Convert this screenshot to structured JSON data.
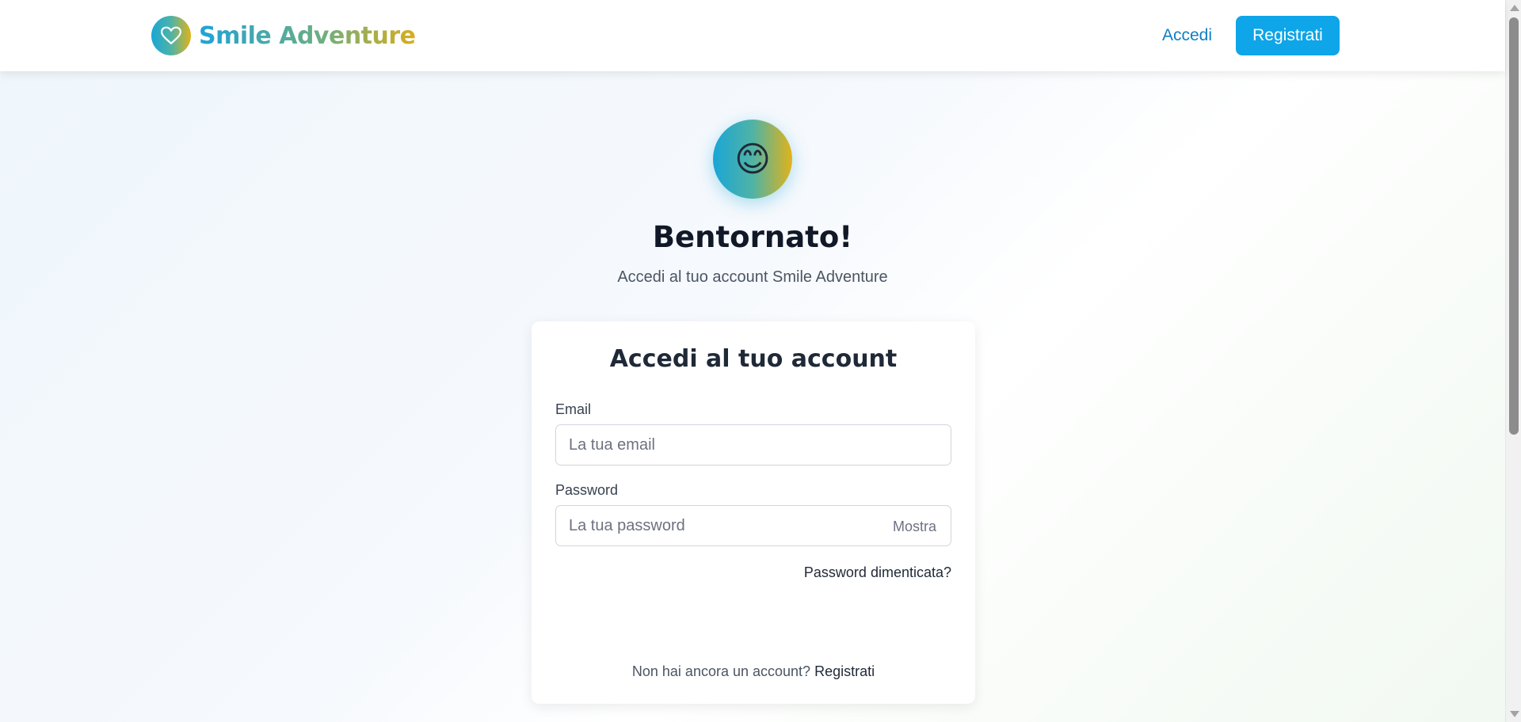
{
  "header": {
    "brand_name": "Smile Adventure",
    "brand_icon": "heart-icon",
    "nav_login_label": "Accedi",
    "nav_register_label": "Registrati"
  },
  "hero": {
    "icon": "smiling-face-emoji",
    "emoji": "😊",
    "title": "Bentornato!",
    "subtitle": "Accedi al tuo account Smile Adventure"
  },
  "login_form": {
    "title": "Accedi al tuo account",
    "email_label": "Email",
    "email_placeholder": "La tua email",
    "email_value": "",
    "password_label": "Password",
    "password_placeholder": "La tua password",
    "password_value": "",
    "show_password_label": "Mostra",
    "forgot_password_label": "Password dimenticata?",
    "no_account_text": "Non hai ancora un account?",
    "register_link_label": "Registrati"
  },
  "colors": {
    "accent": "#0ea5e9",
    "link": "#0e7fc4",
    "brand_gradient_start": "#1aa6d6",
    "brand_gradient_end": "#e0b31a"
  }
}
